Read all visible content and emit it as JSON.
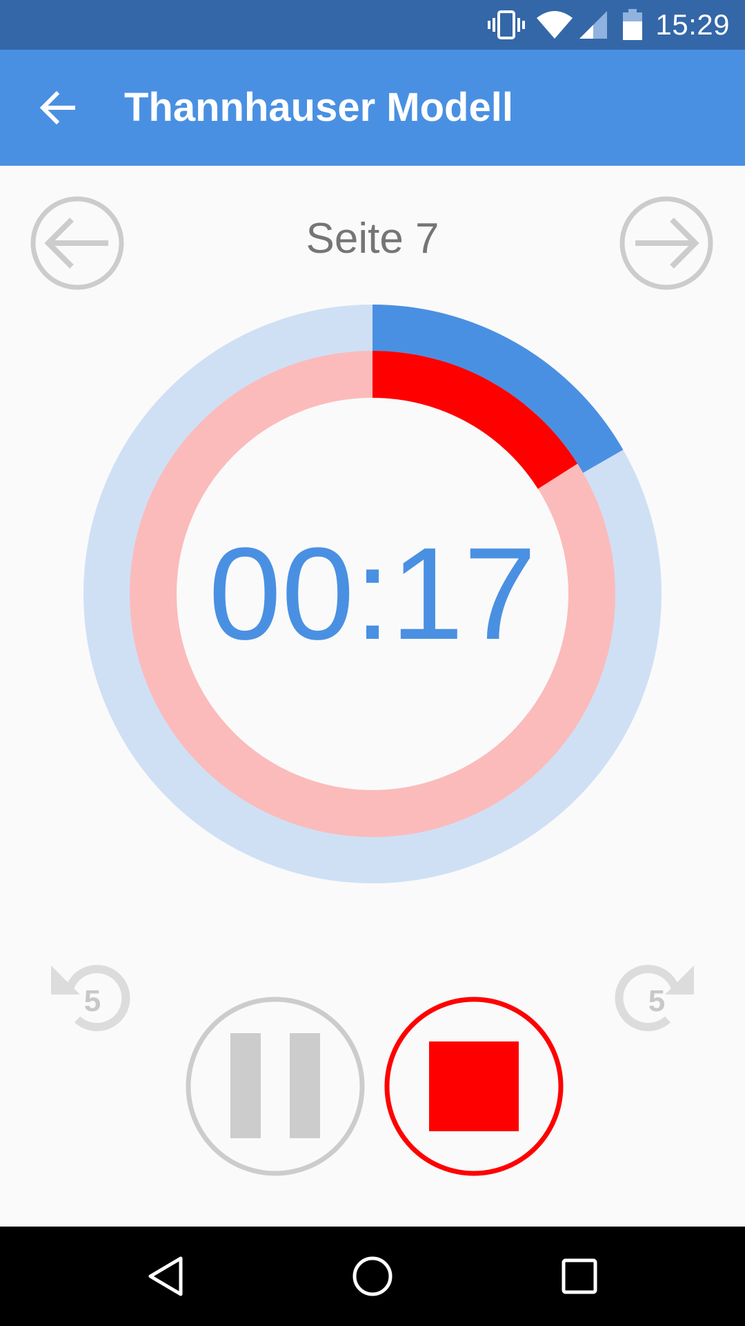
{
  "status_bar": {
    "time": "15:29",
    "icons": [
      "vibrate-icon",
      "wifi-icon",
      "cell-signal-icon",
      "battery-icon"
    ]
  },
  "app_bar": {
    "title": "Thannhauser Modell",
    "back_icon": "arrow-back-icon"
  },
  "pager": {
    "label": "Seite 7",
    "prev_icon": "arrow-left-circle-icon",
    "next_icon": "arrow-right-circle-icon"
  },
  "timer": {
    "display": "00:17",
    "outer_progress": 0.167,
    "inner_progress": 0.16,
    "colors": {
      "outer_track": "#cfe0f5",
      "outer_fill": "#4a90e2",
      "inner_track": "#fbbbbb",
      "inner_fill": "#ff0000",
      "text": "#4a90e2"
    }
  },
  "controls": {
    "rewind_seconds": "5",
    "forward_seconds": "5",
    "pause_icon": "pause-icon",
    "stop_icon": "stop-icon",
    "stop_color": "#ff0000",
    "disabled_color": "#cccccc"
  },
  "system_nav": {
    "back_icon": "triangle-back-icon",
    "home_icon": "circle-home-icon",
    "recents_icon": "square-recents-icon"
  }
}
